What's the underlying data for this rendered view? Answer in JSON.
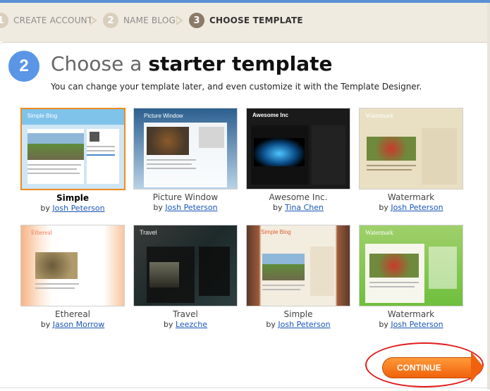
{
  "steps": [
    {
      "num": "1",
      "label": "CREATE ACCOUNT"
    },
    {
      "num": "2",
      "label": "NAME BLOG"
    },
    {
      "num": "3",
      "label": "CHOOSE TEMPLATE"
    }
  ],
  "header": {
    "step_num": "2",
    "title_prefix": "Choose a ",
    "title_bold": "starter template",
    "subtitle": "You can change your template later, and even customize it with the Template Designer."
  },
  "templates": [
    {
      "name": "Simple",
      "by": "by",
      "author": "Josh Peterson",
      "thumb_title": "Simple Blog",
      "selected": true
    },
    {
      "name": "Picture Window",
      "by": "by",
      "author": "Josh Peterson",
      "thumb_title": "Picture Window"
    },
    {
      "name": "Awesome Inc.",
      "by": "by",
      "author": "Tina Chen",
      "thumb_title": "Awesome Inc"
    },
    {
      "name": "Watermark",
      "by": "by",
      "author": "Josh Peterson",
      "thumb_title": "Watermark"
    },
    {
      "name": "Ethereal",
      "by": "by",
      "author": "Jason Morrow",
      "thumb_title": "Ethereal"
    },
    {
      "name": "Travel",
      "by": "by",
      "author": "Leezche",
      "thumb_title": "Travel"
    },
    {
      "name": "Simple",
      "by": "by",
      "author": "Josh Peterson",
      "thumb_title": "Simple Blog"
    },
    {
      "name": "Watermark",
      "by": "by",
      "author": "Josh Peterson",
      "thumb_title": "Watermark"
    }
  ],
  "continue_label": "CONTINUE",
  "colors": {
    "accent_blue": "#5a95e6",
    "continue_orange": "#f0620b",
    "selected_border": "#f08a1c",
    "link": "#1a55b8",
    "highlight_circle": "#e31c1c"
  }
}
